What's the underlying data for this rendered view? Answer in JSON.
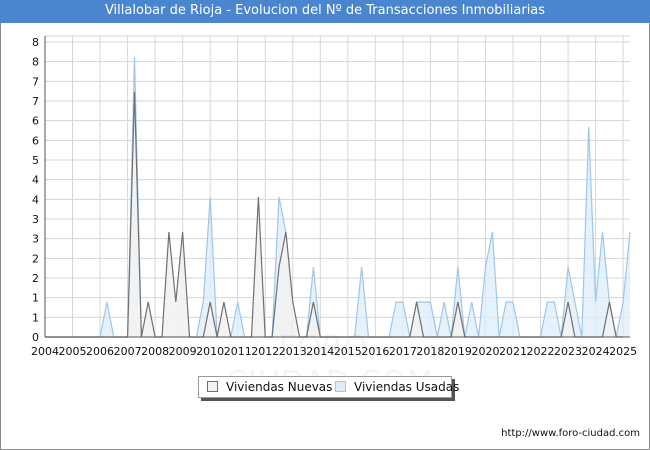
{
  "title": "Villalobar de Rioja - Evolucion del Nº de Transacciones Inmobiliarias",
  "url": "http://www.foro-ciudad.com",
  "watermark": "FORO-CIUDAD.COM",
  "colors": {
    "title_bar": "#4a86d0",
    "nuevas_fill": "#f2f2f2",
    "nuevas_line": "#707070",
    "usadas_fill": "#dcecfa",
    "usadas_line": "#9cc7ef",
    "grid": "#d6d6d6"
  },
  "chart_data": {
    "type": "area",
    "title": "Villalobar de Rioja - Evolucion del Nº de Transacciones Inmobiliarias",
    "xlabel": "",
    "ylabel": "",
    "x_tick_labels": [
      "2004",
      "2005",
      "2006",
      "2007",
      "2008",
      "2009",
      "2010",
      "2011",
      "2012",
      "2013",
      "2014",
      "2015",
      "2016",
      "2017",
      "2018",
      "2019",
      "2020",
      "2021",
      "2022",
      "2023",
      "2024",
      "2025"
    ],
    "y_tick_labels": [
      "0",
      "1",
      "1",
      "2",
      "2",
      "3",
      "3",
      "4",
      "4",
      "5",
      "6",
      "6",
      "7",
      "7",
      "8",
      "8"
    ],
    "ylim": [
      0,
      8.6
    ],
    "grid": true,
    "legend_position": "bottom-center",
    "series": [
      {
        "name": "Viviendas Nuevas",
        "points": [
          [
            2004.0,
            0
          ],
          [
            2006.0,
            0
          ],
          [
            2007.0,
            0
          ],
          [
            2007.25,
            7
          ],
          [
            2007.5,
            0
          ],
          [
            2007.75,
            1
          ],
          [
            2008.0,
            0
          ],
          [
            2008.25,
            0
          ],
          [
            2008.5,
            3
          ],
          [
            2008.75,
            1
          ],
          [
            2009.0,
            3
          ],
          [
            2009.25,
            0
          ],
          [
            2009.75,
            0
          ],
          [
            2010.0,
            1
          ],
          [
            2010.25,
            0
          ],
          [
            2010.5,
            1
          ],
          [
            2010.75,
            0
          ],
          [
            2011.5,
            0
          ],
          [
            2011.75,
            4
          ],
          [
            2012.0,
            0
          ],
          [
            2012.25,
            0
          ],
          [
            2012.5,
            2
          ],
          [
            2012.75,
            3
          ],
          [
            2013.0,
            1
          ],
          [
            2013.25,
            0
          ],
          [
            2013.5,
            0
          ],
          [
            2013.75,
            1
          ],
          [
            2014.0,
            0
          ],
          [
            2017.25,
            0
          ],
          [
            2017.5,
            1
          ],
          [
            2017.75,
            0
          ],
          [
            2018.75,
            0
          ],
          [
            2019.0,
            1
          ],
          [
            2019.25,
            0
          ],
          [
            2022.75,
            0
          ],
          [
            2023.0,
            1
          ],
          [
            2023.25,
            0
          ],
          [
            2024.25,
            0
          ],
          [
            2024.5,
            1
          ],
          [
            2024.75,
            0
          ],
          [
            2025.0,
            0
          ]
        ]
      },
      {
        "name": "Viviendas Usadas",
        "points": [
          [
            2004.0,
            0
          ],
          [
            2006.0,
            0
          ],
          [
            2006.25,
            1
          ],
          [
            2006.5,
            0
          ],
          [
            2007.0,
            0
          ],
          [
            2007.25,
            8
          ],
          [
            2007.5,
            0
          ],
          [
            2009.5,
            0
          ],
          [
            2009.75,
            1
          ],
          [
            2010.0,
            4
          ],
          [
            2010.25,
            0
          ],
          [
            2010.75,
            0
          ],
          [
            2011.0,
            1
          ],
          [
            2011.25,
            0
          ],
          [
            2012.25,
            0
          ],
          [
            2012.5,
            4
          ],
          [
            2012.75,
            3
          ],
          [
            2013.0,
            0
          ],
          [
            2013.5,
            0
          ],
          [
            2013.75,
            2
          ],
          [
            2014.0,
            0
          ],
          [
            2015.25,
            0
          ],
          [
            2015.5,
            2
          ],
          [
            2015.75,
            0
          ],
          [
            2016.5,
            0
          ],
          [
            2016.75,
            1
          ],
          [
            2017.0,
            1
          ],
          [
            2017.25,
            0
          ],
          [
            2017.5,
            1
          ],
          [
            2017.75,
            1
          ],
          [
            2018.0,
            1
          ],
          [
            2018.25,
            0
          ],
          [
            2018.5,
            1
          ],
          [
            2018.75,
            0
          ],
          [
            2019.0,
            2
          ],
          [
            2019.25,
            0
          ],
          [
            2019.5,
            1
          ],
          [
            2019.75,
            0
          ],
          [
            2020.0,
            2
          ],
          [
            2020.25,
            3
          ],
          [
            2020.5,
            0
          ],
          [
            2020.75,
            1
          ],
          [
            2021.0,
            1
          ],
          [
            2021.25,
            0
          ],
          [
            2022.0,
            0
          ],
          [
            2022.25,
            1
          ],
          [
            2022.5,
            1
          ],
          [
            2022.75,
            0
          ],
          [
            2023.0,
            2
          ],
          [
            2023.25,
            1
          ],
          [
            2023.5,
            0
          ],
          [
            2023.75,
            6
          ],
          [
            2024.0,
            1
          ],
          [
            2024.25,
            3
          ],
          [
            2024.5,
            1
          ],
          [
            2024.75,
            0
          ],
          [
            2025.0,
            1
          ],
          [
            2025.25,
            3
          ]
        ]
      }
    ]
  }
}
